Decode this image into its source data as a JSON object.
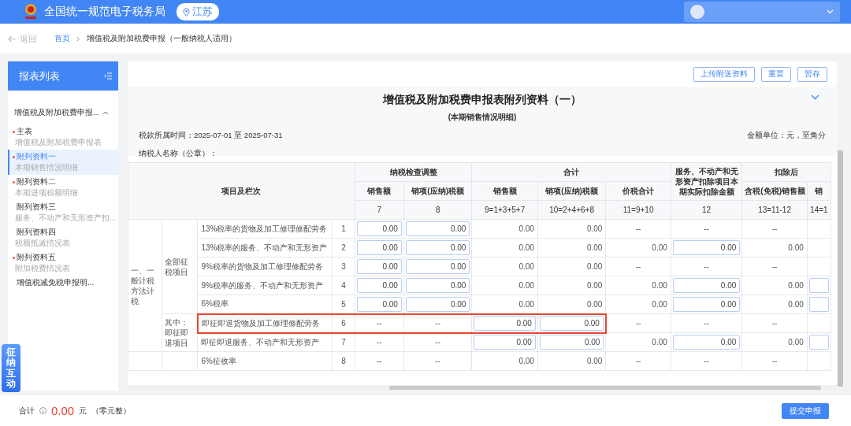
{
  "header": {
    "site_title": "全国统一规范电子税务局",
    "location": "江苏"
  },
  "breadcrumb": {
    "back": "返回",
    "items": [
      {
        "label": "首页",
        "link": true
      },
      {
        "label": "增值税及附加税费申报（一般纳税人适用）",
        "link": false
      }
    ]
  },
  "sidebar": {
    "title": "报表列表",
    "section": {
      "label": "增值税及附加税费申报...",
      "expanded": true
    },
    "items": [
      {
        "name": "主表",
        "desc": "增值税及附加税费申报表",
        "required": true,
        "selected": false
      },
      {
        "name": "附列资料一",
        "desc": "本期销售情况明细",
        "required": true,
        "selected": true
      },
      {
        "name": "附列资料二",
        "desc": "本期进项税额明细",
        "required": true,
        "selected": false
      },
      {
        "name": "附列资料三",
        "desc": "服务、不动产和无形资产扣...",
        "required": false,
        "selected": false
      },
      {
        "name": "附列资料四",
        "desc": "税额抵减情况表",
        "required": false,
        "selected": false
      },
      {
        "name": "附列资料五",
        "desc": "附加税费情况表",
        "required": true,
        "selected": false
      },
      {
        "name": "增值税减免税申报明...",
        "required": false,
        "selected": false
      }
    ]
  },
  "float_button": "征纳互动",
  "toolbar": [
    "上传附送资料",
    "重置",
    "暂存"
  ],
  "form": {
    "title": "增值税及附加税费申报表附列资料（一）",
    "subtitle": "(本期销售情况明细)",
    "period": "税款所属时间：2025-07-01 至 2025-07-31",
    "unit": "金额单位：元，至角分",
    "taxpayer": "纳税人名称（公章）："
  },
  "table": {
    "item_header": "项目及栏次",
    "groups": [
      {
        "label": "纳税检查调整",
        "columns": [
          {
            "label": "销售额",
            "formula": "7"
          },
          {
            "label": "销项(应纳)税额",
            "formula": "8"
          }
        ]
      },
      {
        "label": "合计",
        "columns": [
          {
            "label": "销售额",
            "formula": "9=1+3+5+7"
          },
          {
            "label": "销项(应纳)税额",
            "formula": "10=2+4+6+8"
          },
          {
            "label": "价税合计",
            "formula": "11=9+10"
          }
        ]
      },
      {
        "label": "服务、不动产和无形资产扣除项目本期实际扣除金额",
        "columns": [
          {
            "formula": "12"
          }
        ]
      },
      {
        "label": "扣除后",
        "columns": [
          {
            "label": "含税(免税)销售额",
            "formula": "13=11-12"
          },
          {
            "label": "销",
            "formula": "14=1"
          }
        ]
      }
    ],
    "sections": [
      {
        "label": "一、一般计税方法计税",
        "subsections": [
          {
            "label": "全部征税项目",
            "rows": [
              {
                "item": "13%税率的货物及加工修理修配劳务",
                "line": "1",
                "highlighted": false,
                "cells": [
                  {
                    "kind": "input",
                    "value": "0.00"
                  },
                  {
                    "kind": "input",
                    "value": "0.00"
                  },
                  {
                    "kind": "number",
                    "value": "0.00"
                  },
                  {
                    "kind": "number",
                    "value": "0.00"
                  },
                  {
                    "kind": "dash",
                    "value": "--"
                  },
                  {
                    "kind": "dash",
                    "value": "--"
                  },
                  {
                    "kind": "dash",
                    "value": "--"
                  },
                  {
                    "kind": "blank"
                  }
                ]
              },
              {
                "item": "13%税率的服务、不动产和无形资产",
                "line": "2",
                "highlighted": false,
                "cells": [
                  {
                    "kind": "input",
                    "value": "0.00"
                  },
                  {
                    "kind": "input",
                    "value": "0.00"
                  },
                  {
                    "kind": "number",
                    "value": "0.00"
                  },
                  {
                    "kind": "number",
                    "value": "0.00"
                  },
                  {
                    "kind": "number",
                    "value": "0.00"
                  },
                  {
                    "kind": "input",
                    "value": "0.00"
                  },
                  {
                    "kind": "number",
                    "value": "0.00"
                  },
                  {
                    "kind": "blank"
                  }
                ]
              },
              {
                "item": "9%税率的货物及加工修理修配劳务",
                "line": "3",
                "highlighted": false,
                "cells": [
                  {
                    "kind": "input",
                    "value": "0.00"
                  },
                  {
                    "kind": "input",
                    "value": "0.00"
                  },
                  {
                    "kind": "number",
                    "value": "0.00"
                  },
                  {
                    "kind": "number",
                    "value": "0.00"
                  },
                  {
                    "kind": "dash",
                    "value": "--"
                  },
                  {
                    "kind": "dash",
                    "value": "--"
                  },
                  {
                    "kind": "dash",
                    "value": "--"
                  },
                  {
                    "kind": "blank"
                  }
                ]
              },
              {
                "item": "9%税率的服务、不动产和无形资产",
                "line": "4",
                "highlighted": false,
                "cells": [
                  {
                    "kind": "input",
                    "value": "0.00"
                  },
                  {
                    "kind": "input",
                    "value": "0.00"
                  },
                  {
                    "kind": "number",
                    "value": "0.00"
                  },
                  {
                    "kind": "number",
                    "value": "0.00"
                  },
                  {
                    "kind": "number",
                    "value": "0.00"
                  },
                  {
                    "kind": "input",
                    "value": "0.00"
                  },
                  {
                    "kind": "number",
                    "value": "0.00"
                  },
                  {
                    "kind": "input"
                  }
                ]
              },
              {
                "item": "6%税率",
                "line": "5",
                "highlighted": false,
                "cells": [
                  {
                    "kind": "input",
                    "value": "0.00"
                  },
                  {
                    "kind": "input",
                    "value": "0.00"
                  },
                  {
                    "kind": "number",
                    "value": "0.00"
                  },
                  {
                    "kind": "number",
                    "value": "0.00"
                  },
                  {
                    "kind": "number",
                    "value": "0.00"
                  },
                  {
                    "kind": "input",
                    "value": "0.00"
                  },
                  {
                    "kind": "number",
                    "value": "0.00"
                  },
                  {
                    "kind": "input"
                  }
                ]
              }
            ]
          },
          {
            "label": "其中：即征即退项目",
            "rows": [
              {
                "item": "即征即退货物及加工修理修配劳务",
                "line": "6",
                "highlighted": true,
                "cells": [
                  {
                    "kind": "dash",
                    "value": "--"
                  },
                  {
                    "kind": "dash",
                    "value": "--"
                  },
                  {
                    "kind": "input",
                    "value": "0.00"
                  },
                  {
                    "kind": "input",
                    "value": "0.00"
                  },
                  {
                    "kind": "dash",
                    "value": "--"
                  },
                  {
                    "kind": "dash",
                    "value": "--"
                  },
                  {
                    "kind": "dash",
                    "value": "--"
                  },
                  {
                    "kind": "blank"
                  }
                ]
              },
              {
                "item": "即征即退服务、不动产和无形资产",
                "line": "7",
                "highlighted": false,
                "cells": [
                  {
                    "kind": "dash",
                    "value": "--"
                  },
                  {
                    "kind": "dash",
                    "value": "--"
                  },
                  {
                    "kind": "input",
                    "value": "0.00"
                  },
                  {
                    "kind": "input",
                    "value": "0.00"
                  },
                  {
                    "kind": "number",
                    "value": "0.00"
                  },
                  {
                    "kind": "input",
                    "value": "0.00"
                  },
                  {
                    "kind": "number",
                    "value": "0.00"
                  },
                  {
                    "kind": "input"
                  }
                ]
              }
            ]
          }
        ]
      },
      {
        "subsections": [
          {
            "rows": [
              {
                "item": "6%征收率",
                "line": "8",
                "highlighted": false,
                "cells": [
                  {
                    "kind": "dash",
                    "value": "--"
                  },
                  {
                    "kind": "dash",
                    "value": "--"
                  },
                  {
                    "kind": "number",
                    "value": "0.00"
                  },
                  {
                    "kind": "number",
                    "value": "0.00"
                  },
                  {
                    "kind": "dash",
                    "value": "--"
                  },
                  {
                    "kind": "dash",
                    "value": "--"
                  },
                  {
                    "kind": "dash",
                    "value": "--"
                  },
                  {
                    "kind": "blank"
                  }
                ]
              }
            ]
          }
        ]
      }
    ]
  },
  "footer": {
    "total_label": "合计",
    "amount": "0.00",
    "currency": "元",
    "amount_words": "（零元整）",
    "submit": "提交申报"
  }
}
